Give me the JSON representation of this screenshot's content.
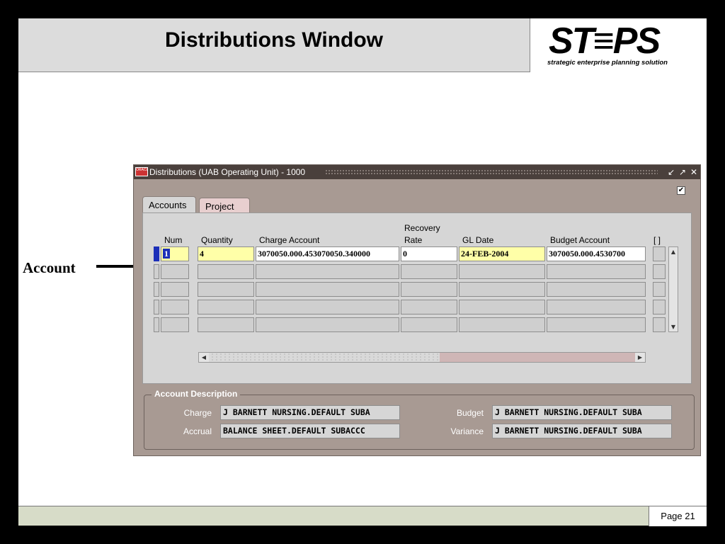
{
  "slide": {
    "title": "Distributions Window",
    "logo_word": "ST≡PS",
    "logo_tagline": "strategic enterprise planning solution",
    "page_label": "Page 21",
    "callout_label": "Account"
  },
  "window": {
    "icon_text": "ORACLE",
    "title": "Distributions (UAB Operating Unit) - 1000",
    "controls": [
      "↙",
      "↗",
      "✕"
    ],
    "checkbox_mark": "✔"
  },
  "tabs": [
    {
      "label": "Accounts",
      "active": true
    },
    {
      "label": "Project",
      "active": false
    }
  ],
  "table": {
    "headers": {
      "num": "Num",
      "quantity": "Quantity",
      "charge_account": "Charge Account",
      "recovery_rate_1": "Recovery",
      "recovery_rate_2": "Rate",
      "gl_date": "GL Date",
      "budget_account": "Budget Account",
      "flex": "[ ]"
    },
    "rows": [
      {
        "num": "1",
        "quantity": "4",
        "charge_account": "3070050.000.453070050.340000",
        "recovery_rate": "0",
        "gl_date": "24-FEB-2004",
        "budget_account": "3070050.000.4530700"
      },
      {
        "num": "",
        "quantity": "",
        "charge_account": "",
        "recovery_rate": "",
        "gl_date": "",
        "budget_account": ""
      },
      {
        "num": "",
        "quantity": "",
        "charge_account": "",
        "recovery_rate": "",
        "gl_date": "",
        "budget_account": ""
      },
      {
        "num": "",
        "quantity": "",
        "charge_account": "",
        "recovery_rate": "",
        "gl_date": "",
        "budget_account": ""
      },
      {
        "num": "",
        "quantity": "",
        "charge_account": "",
        "recovery_rate": "",
        "gl_date": "",
        "budget_account": ""
      }
    ]
  },
  "account_description": {
    "title": "Account Description",
    "charge_label": "Charge",
    "charge_value": "J BARNETT NURSING.DEFAULT SUBA",
    "accrual_label": "Accrual",
    "accrual_value": "BALANCE SHEET.DEFAULT SUBACCC",
    "budget_label": "Budget",
    "budget_value": "J BARNETT NURSING.DEFAULT SUBA",
    "variance_label": "Variance",
    "variance_value": "J BARNETT NURSING.DEFAULT SUBA"
  },
  "colors": {
    "window_bg": "#a89a93",
    "titlebar": "#4a403c",
    "required_field": "#ffffa8",
    "focus": "#1c2fb8",
    "footer": "#d7dcc8"
  }
}
